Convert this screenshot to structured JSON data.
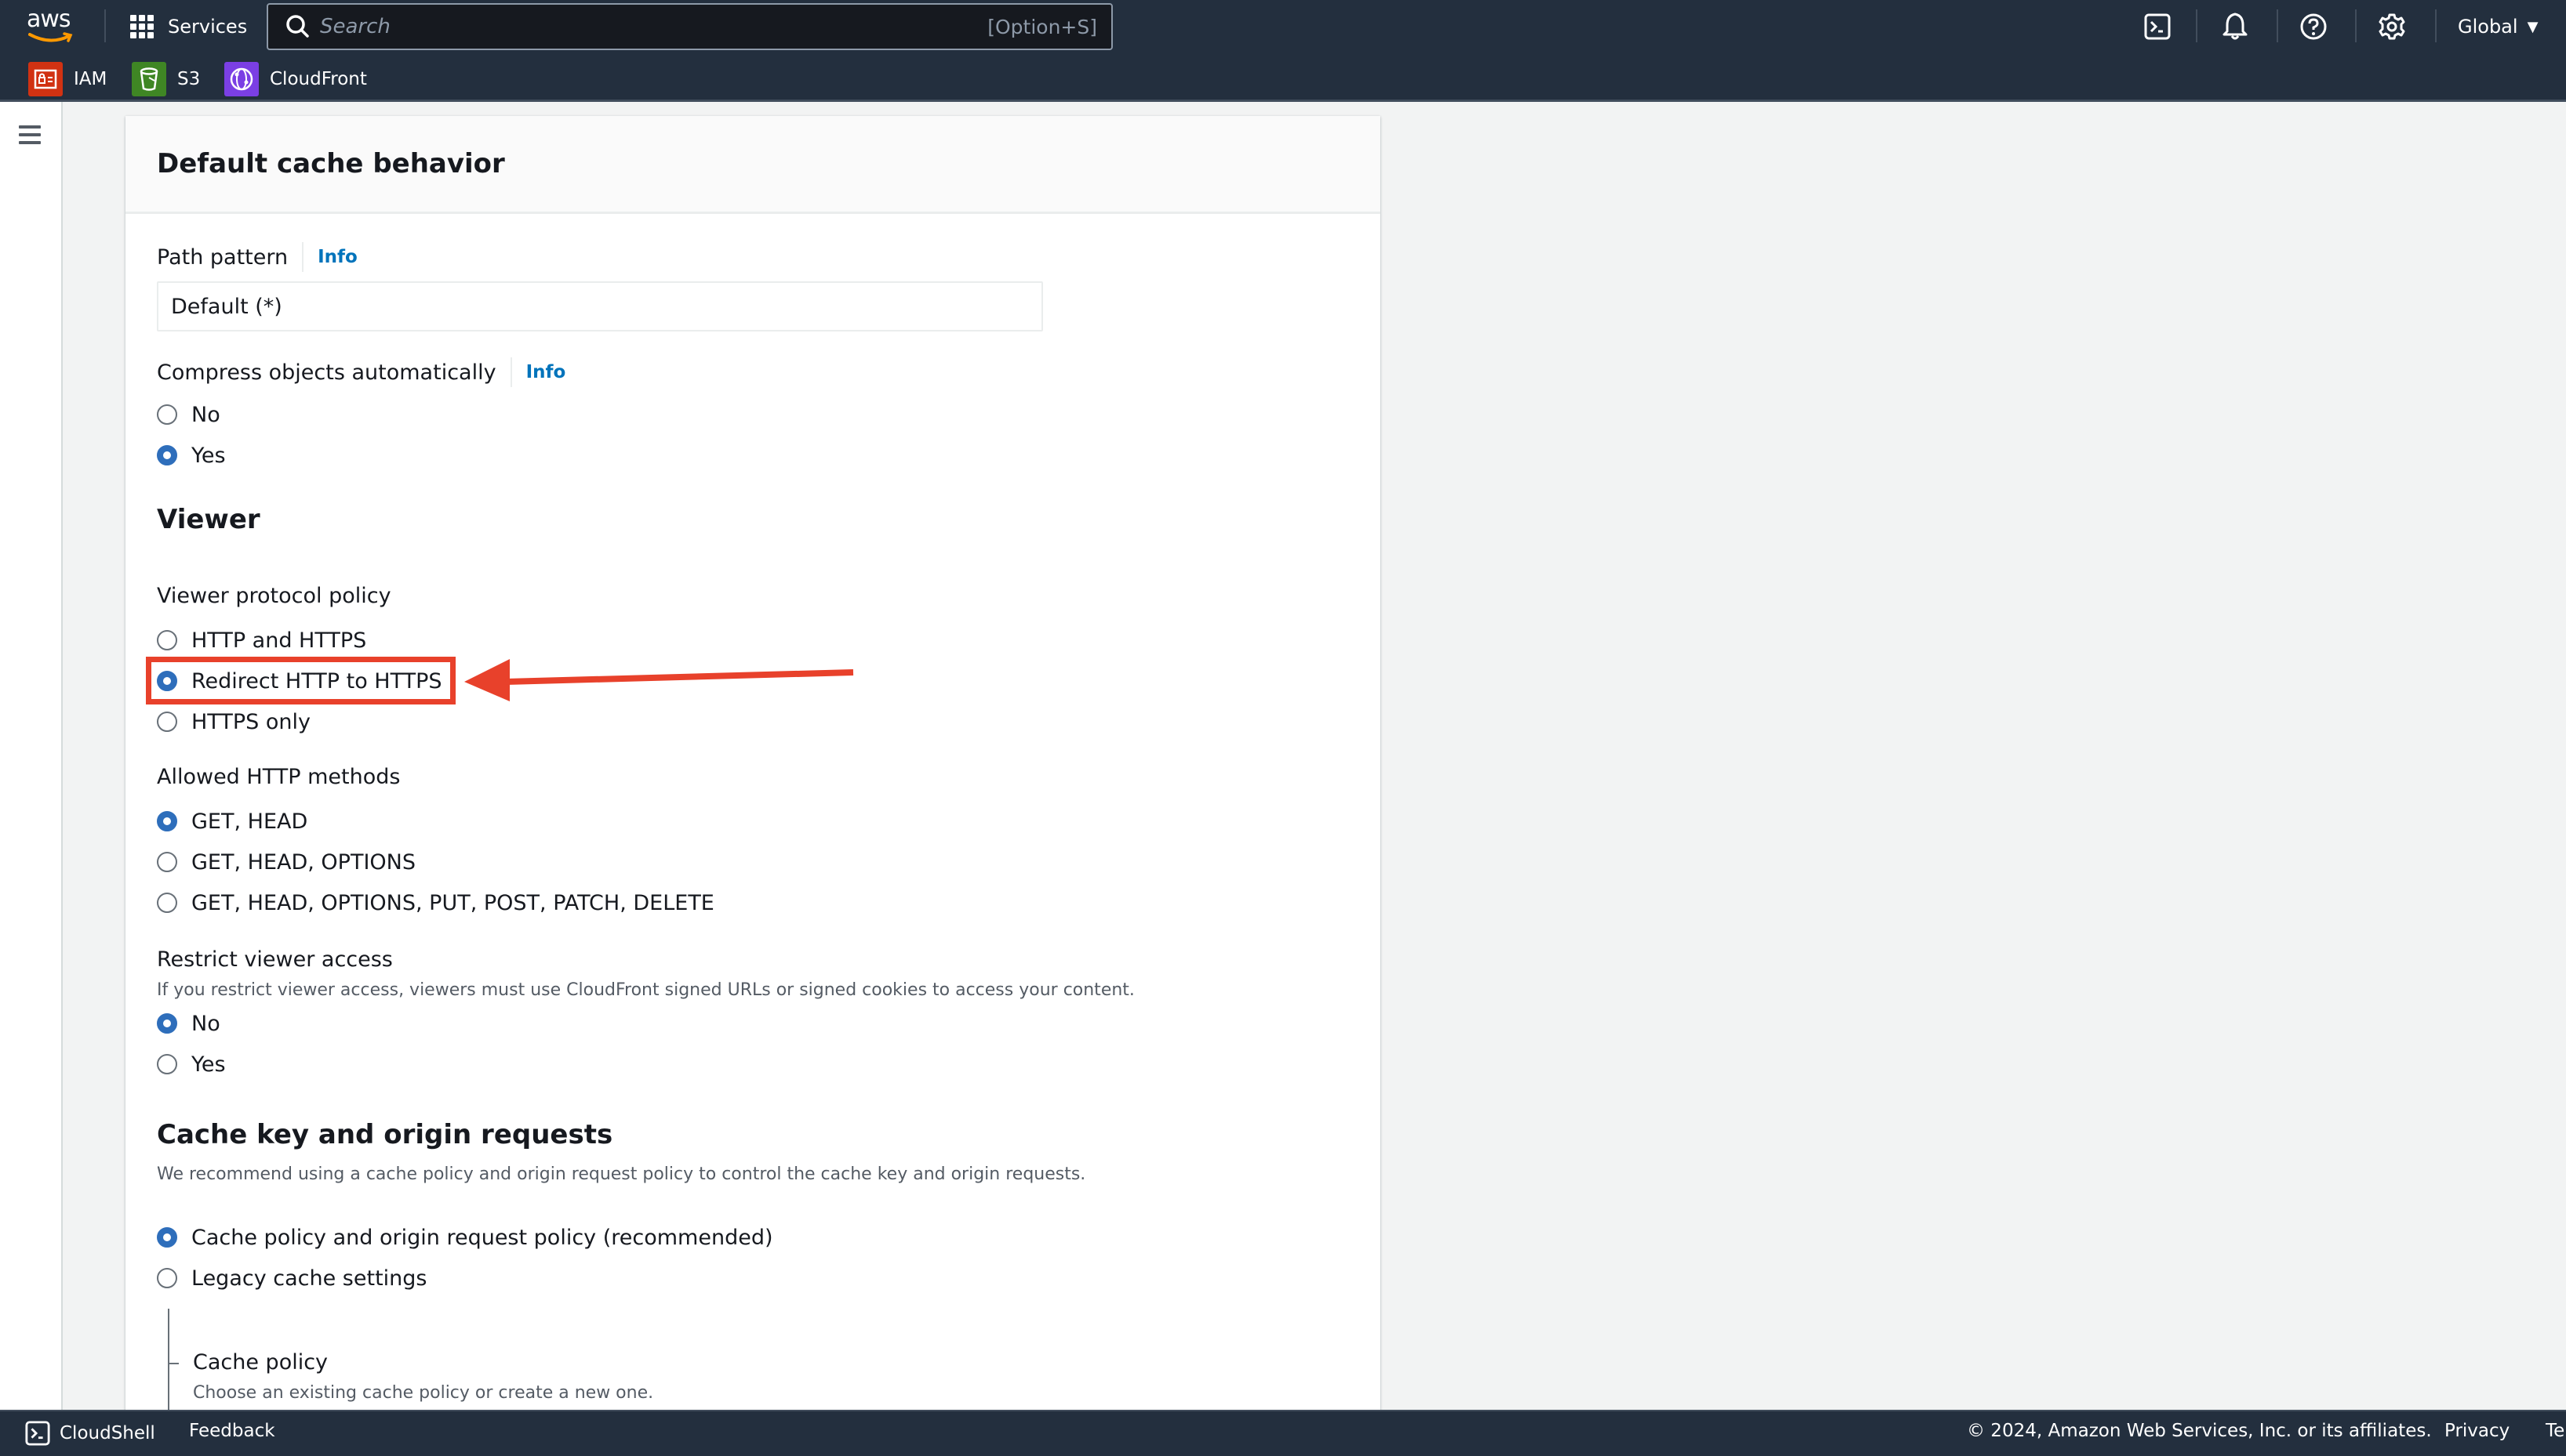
{
  "topnav": {
    "logo_text": "aws",
    "services_label": "Services",
    "search_placeholder": "Search",
    "search_shortcut": "[Option+S]",
    "icons": [
      "cloudshell-icon",
      "notifications-bell-icon",
      "help-icon",
      "settings-gear-icon"
    ],
    "region_label": "Global"
  },
  "favorites": [
    {
      "label": "IAM",
      "color": "#d13212"
    },
    {
      "label": "S3",
      "color": "#3f8624"
    },
    {
      "label": "CloudFront",
      "color": "#8c4fff"
    }
  ],
  "card": {
    "title": "Default cache behavior",
    "path_pattern": {
      "label": "Path pattern",
      "info": "Info",
      "value": "Default (*)"
    },
    "compress": {
      "label": "Compress objects automatically",
      "info": "Info",
      "options": [
        "No",
        "Yes"
      ],
      "selected": "Yes"
    },
    "viewer": {
      "title": "Viewer",
      "protocol_policy": {
        "label": "Viewer protocol policy",
        "options": [
          "HTTP and HTTPS",
          "Redirect HTTP to HTTPS",
          "HTTPS only"
        ],
        "selected": "Redirect HTTP to HTTPS"
      },
      "allowed_methods": {
        "label": "Allowed HTTP methods",
        "options": [
          "GET, HEAD",
          "GET, HEAD, OPTIONS",
          "GET, HEAD, OPTIONS, PUT, POST, PATCH, DELETE"
        ],
        "selected": "GET, HEAD"
      },
      "restrict_access": {
        "label": "Restrict viewer access",
        "description": "If you restrict viewer access, viewers must use CloudFront signed URLs or signed cookies to access your content.",
        "options": [
          "No",
          "Yes"
        ],
        "selected": "No"
      }
    },
    "cache_key": {
      "title": "Cache key and origin requests",
      "description": "We recommend using a cache policy and origin request policy to control the cache key and origin requests.",
      "options": [
        "Cache policy and origin request policy (recommended)",
        "Legacy cache settings"
      ],
      "selected": "Cache policy and origin request policy (recommended)",
      "cache_policy": {
        "label": "Cache policy",
        "description": "Choose an existing cache policy or create a new one."
      }
    }
  },
  "annotation": {
    "color": "#e8412b",
    "target": "Redirect HTTP to HTTPS"
  },
  "footer": {
    "cloudshell": "CloudShell",
    "feedback": "Feedback",
    "copyright": "© 2024, Amazon Web Services, Inc. or its affiliates.",
    "privacy": "Privacy",
    "terms": "Te"
  }
}
